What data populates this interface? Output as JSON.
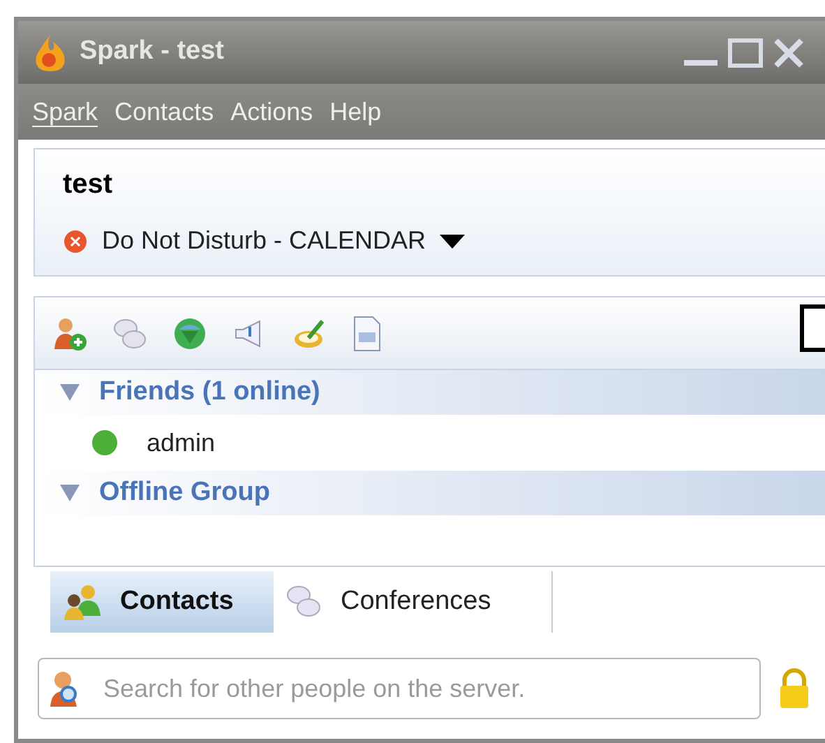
{
  "window": {
    "title": "Spark - test"
  },
  "menu": [
    {
      "label": "Spark"
    },
    {
      "label": "Contacts"
    },
    {
      "label": "Actions"
    },
    {
      "label": "Help"
    }
  ],
  "profile": {
    "name": "test",
    "status": "Do Not Disturb - CALENDAR"
  },
  "groups": [
    {
      "label": "Friends (1 online)",
      "expanded": true,
      "children": [
        {
          "name": "admin",
          "color": "#4caf3a"
        }
      ]
    },
    {
      "label": "Offline Group",
      "expanded": true
    }
  ],
  "tabs": [
    {
      "label": "Contacts",
      "selected": true
    },
    {
      "label": "Conferences",
      "selected": false
    }
  ],
  "search": {
    "placeholder": "Search for other people on the server."
  }
}
